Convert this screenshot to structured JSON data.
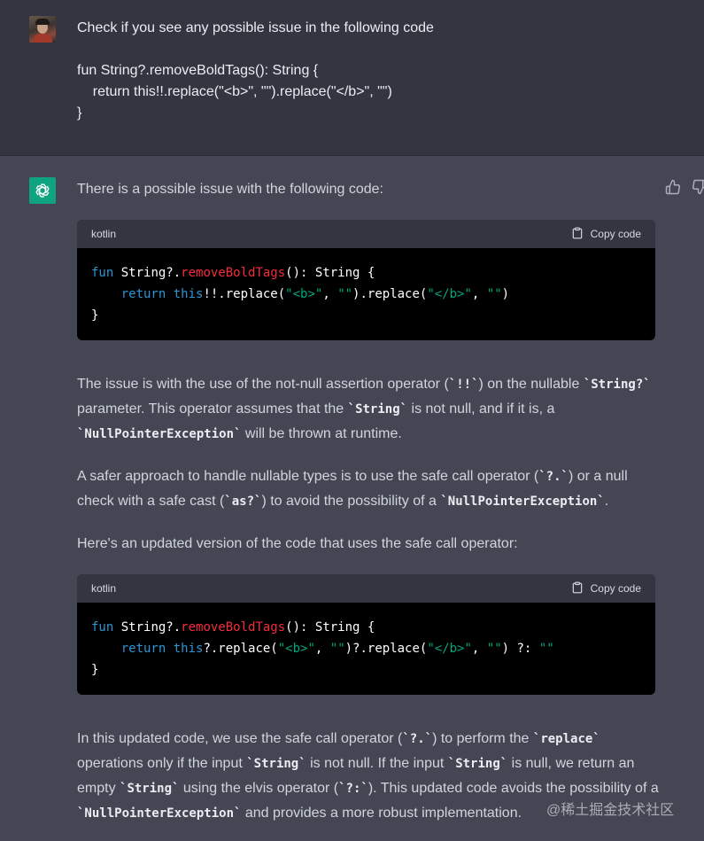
{
  "user": {
    "prompt_lines": [
      "Check if you see any possible issue in the following code",
      "",
      "fun String?.removeBoldTags(): String {",
      "    return this!!.replace(\"<b>\", \"\").replace(\"</b>\", \"\")",
      "}"
    ]
  },
  "assistant": {
    "intro": "There is a possible issue with the following code:",
    "code_block_1": {
      "language": "kotlin",
      "copy_label": "Copy code",
      "lines": [
        [
          {
            "t": "fun",
            "c": "kw"
          },
          {
            "t": " String?."
          },
          {
            "t": "removeBoldTags",
            "c": "fn"
          },
          {
            "t": "(): String {"
          }
        ],
        [
          {
            "t": "    "
          },
          {
            "t": "return",
            "c": "kw"
          },
          {
            "t": " "
          },
          {
            "t": "this",
            "c": "kw"
          },
          {
            "t": "!!.replace("
          },
          {
            "t": "\"<b>\"",
            "c": "str"
          },
          {
            "t": ", "
          },
          {
            "t": "\"\"",
            "c": "str"
          },
          {
            "t": ").replace("
          },
          {
            "t": "\"</b>\"",
            "c": "str"
          },
          {
            "t": ", "
          },
          {
            "t": "\"\"",
            "c": "str"
          },
          {
            "t": ")"
          }
        ],
        [
          {
            "t": "}"
          }
        ]
      ]
    },
    "paragraph_1": [
      {
        "t": "The issue is with the use of the not-null assertion operator ("
      },
      {
        "t": "`!!`",
        "code": true
      },
      {
        "t": ") on the nullable "
      },
      {
        "t": "`String?`",
        "code": true
      },
      {
        "t": " parameter. This operator assumes that the "
      },
      {
        "t": "`String`",
        "code": true
      },
      {
        "t": " is not null, and if it is, a "
      },
      {
        "t": "`NullPointerException`",
        "code": true
      },
      {
        "t": " will be thrown at runtime."
      }
    ],
    "paragraph_2": [
      {
        "t": "A safer approach to handle nullable types is to use the safe call operator ("
      },
      {
        "t": "`?.`",
        "code": true
      },
      {
        "t": ") or a null check with a safe cast ("
      },
      {
        "t": "`as?`",
        "code": true
      },
      {
        "t": ") to avoid the possibility of a "
      },
      {
        "t": "`NullPointerException`",
        "code": true
      },
      {
        "t": "."
      }
    ],
    "paragraph_3": "Here's an updated version of the code that uses the safe call operator:",
    "code_block_2": {
      "language": "kotlin",
      "copy_label": "Copy code",
      "lines": [
        [
          {
            "t": "fun",
            "c": "kw"
          },
          {
            "t": " String?."
          },
          {
            "t": "removeBoldTags",
            "c": "fn"
          },
          {
            "t": "(): String {"
          }
        ],
        [
          {
            "t": "    "
          },
          {
            "t": "return",
            "c": "kw"
          },
          {
            "t": " "
          },
          {
            "t": "this",
            "c": "kw"
          },
          {
            "t": "?.replace("
          },
          {
            "t": "\"<b>\"",
            "c": "str"
          },
          {
            "t": ", "
          },
          {
            "t": "\"\"",
            "c": "str"
          },
          {
            "t": ")?.replace("
          },
          {
            "t": "\"</b>\"",
            "c": "str"
          },
          {
            "t": ", "
          },
          {
            "t": "\"\"",
            "c": "str"
          },
          {
            "t": ") ?: "
          },
          {
            "t": "\"\"",
            "c": "str"
          }
        ],
        [
          {
            "t": "}"
          }
        ]
      ]
    },
    "paragraph_4": [
      {
        "t": "In this updated code, we use the safe call operator ("
      },
      {
        "t": "`?.`",
        "code": true
      },
      {
        "t": ") to perform the "
      },
      {
        "t": "`replace`",
        "code": true
      },
      {
        "t": " operations only if the input "
      },
      {
        "t": "`String`",
        "code": true
      },
      {
        "t": " is not null. If the input "
      },
      {
        "t": "`String`",
        "code": true
      },
      {
        "t": " is null, we return an empty "
      },
      {
        "t": "`String`",
        "code": true
      },
      {
        "t": " using the elvis operator ("
      },
      {
        "t": "`?:`",
        "code": true
      },
      {
        "t": "). This updated code avoids the possibility of a "
      },
      {
        "t": "`NullPointerException`",
        "code": true
      },
      {
        "t": " and provides a more robust implementation."
      }
    ]
  },
  "watermark": "@稀土掘金技术社区",
  "colors": {
    "user_bg": "#343541",
    "assistant_bg": "#444654",
    "gpt_green": "#10a37f",
    "code_keyword": "#2e95d3",
    "code_function": "#f22c3d",
    "code_string": "#00a67d"
  },
  "icons": {
    "thumbs_up": "thumbs-up-icon",
    "thumbs_down": "thumbs-down-icon",
    "clipboard": "clipboard-icon",
    "openai": "openai-logo-icon"
  }
}
